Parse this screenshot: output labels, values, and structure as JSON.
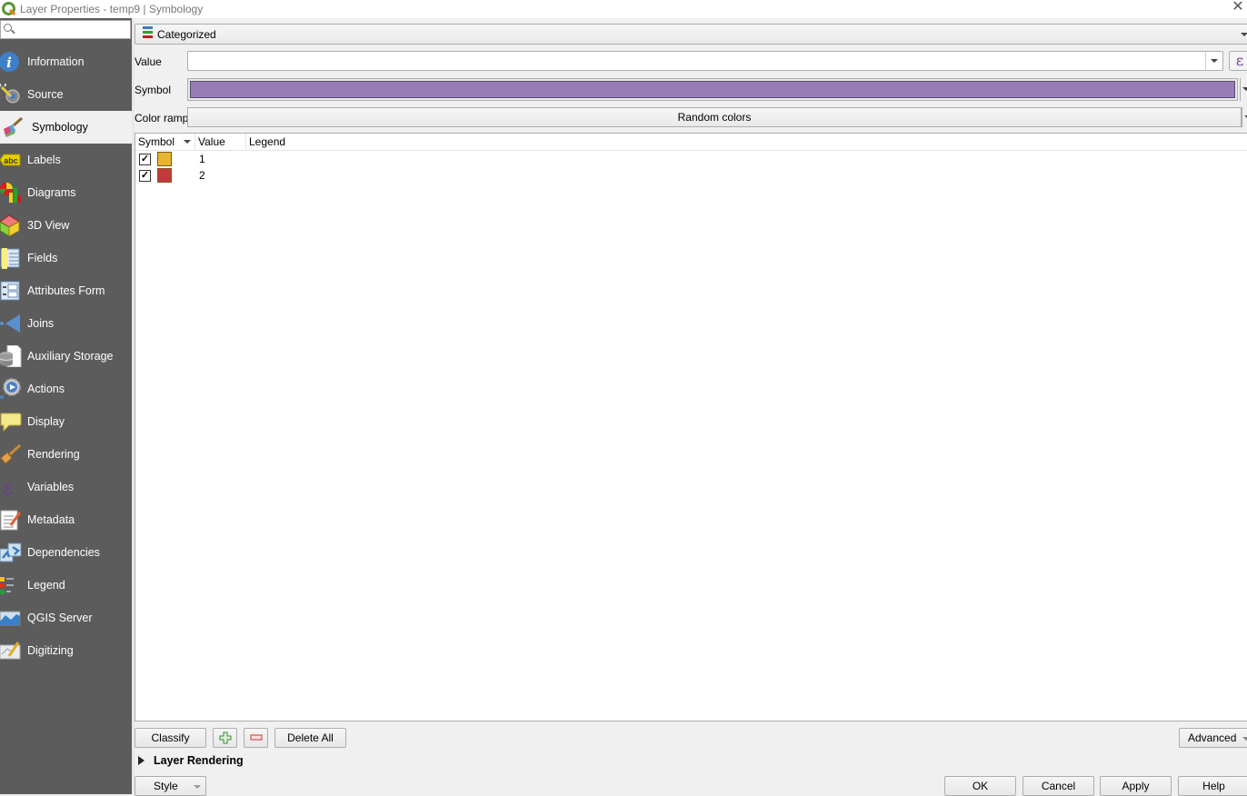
{
  "window": {
    "title": "Layer Properties - temp9 | Symbology",
    "close_icon": "close-icon"
  },
  "sidebar": {
    "search_placeholder": "",
    "items": [
      {
        "label": "Information",
        "icon": "info-icon",
        "active": false
      },
      {
        "label": "Source",
        "icon": "source-wrench-icon",
        "active": false
      },
      {
        "label": "Symbology",
        "icon": "paintbrush-icon",
        "active": true
      },
      {
        "label": "Labels",
        "icon": "abc-label-icon",
        "active": false
      },
      {
        "label": "Diagrams",
        "icon": "diagram-icon",
        "active": false
      },
      {
        "label": "3D View",
        "icon": "cube-icon",
        "active": false
      },
      {
        "label": "Fields",
        "icon": "fields-icon",
        "active": false
      },
      {
        "label": "Attributes Form",
        "icon": "form-icon",
        "active": false
      },
      {
        "label": "Joins",
        "icon": "join-icon",
        "active": false
      },
      {
        "label": "Auxiliary Storage",
        "icon": "database-icon",
        "active": false
      },
      {
        "label": "Actions",
        "icon": "gear-play-icon",
        "active": false
      },
      {
        "label": "Display",
        "icon": "speech-bubble-icon",
        "active": false
      },
      {
        "label": "Rendering",
        "icon": "brush-icon",
        "active": false
      },
      {
        "label": "Variables",
        "icon": "epsilon-icon",
        "active": false
      },
      {
        "label": "Metadata",
        "icon": "metadata-icon",
        "active": false
      },
      {
        "label": "Dependencies",
        "icon": "dependencies-icon",
        "active": false
      },
      {
        "label": "Legend",
        "icon": "legend-icon",
        "active": false
      },
      {
        "label": "QGIS Server",
        "icon": "server-map-icon",
        "active": false
      },
      {
        "label": "Digitizing",
        "icon": "digitizing-icon",
        "active": false
      }
    ]
  },
  "symbology": {
    "renderer": "Categorized",
    "value_label": "Value",
    "value": "",
    "expression_icon": "ε",
    "symbol_label": "Symbol",
    "symbol_color": "#987cb6",
    "color_ramp_label": "Color ramp",
    "color_ramp": "Random colors",
    "table": {
      "columns": [
        "Symbol",
        "Value",
        "Legend"
      ],
      "rows": [
        {
          "checked": true,
          "check": "✓",
          "color": "#e8b530",
          "value": "1",
          "legend": ""
        },
        {
          "checked": true,
          "check": "✓",
          "color": "#c43a3a",
          "value": "2",
          "legend": ""
        }
      ]
    },
    "buttons": {
      "classify": "Classify",
      "add": "add-class-icon",
      "remove": "remove-class-icon",
      "delete_all": "Delete All",
      "advanced": "Advanced"
    },
    "layer_rendering": "Layer Rendering"
  },
  "footer": {
    "style": "Style",
    "ok": "OK",
    "cancel": "Cancel",
    "apply": "Apply",
    "help": "Help"
  }
}
